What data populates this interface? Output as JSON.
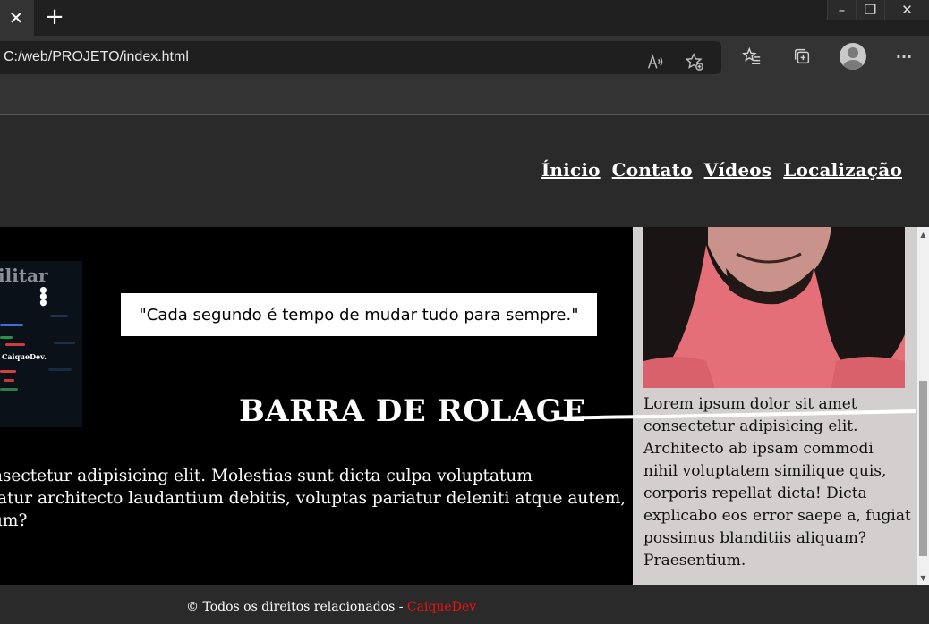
{
  "browser": {
    "tab_close_glyph": "✕",
    "new_tab_glyph": "+",
    "window_controls": {
      "minimize": "–",
      "restore": "❐",
      "close": "✕"
    },
    "url": "C:/web/PROJETO/index.html",
    "icons": [
      "read-aloud-icon",
      "add-favorite-icon",
      "favorites-icon",
      "collections-icon",
      "profile-icon",
      "more-icon"
    ],
    "more_glyph": "···"
  },
  "nav": {
    "items": [
      "Ínicio",
      "Contato",
      "Vídeos",
      "Localização"
    ]
  },
  "thumbnail": {
    "title_fragment": "ilitar",
    "caption": "CaiqueDev."
  },
  "quote": "\"Cada segundo é tempo de mudar tudo para sempre.\"",
  "annotation_heading": "BARRA DE ROLAGE",
  "main_paragraph": {
    "lines": [
      "nsectetur adipisicing elit. Molestias sunt dicta culpa voluptatum",
      "iatur architecto laudantium debitis, voluptas pariatur deleniti atque autem,",
      "um?"
    ]
  },
  "aside": {
    "text": "Lorem ipsum dolor sit amet consectetur adipisicing elit. Architecto ab ipsam commodi nihil voluptatem similique quis, corporis repellat dicta! Dicta explicabo eos error saepe a, fugiat possimus blanditiis aliquam? Praesentium."
  },
  "scrollbar": {
    "up_glyph": "▲",
    "down_glyph": "▼"
  },
  "footer": {
    "text": "© Todos os direitos relacionados - ",
    "brand": "CaiqueDev"
  },
  "colors": {
    "header_bg": "#2a2a2a",
    "main_bg": "#000000",
    "aside_bg": "#d4cfcf",
    "brand_red": "#ee1111",
    "shirt_pink": "#e56f78"
  }
}
